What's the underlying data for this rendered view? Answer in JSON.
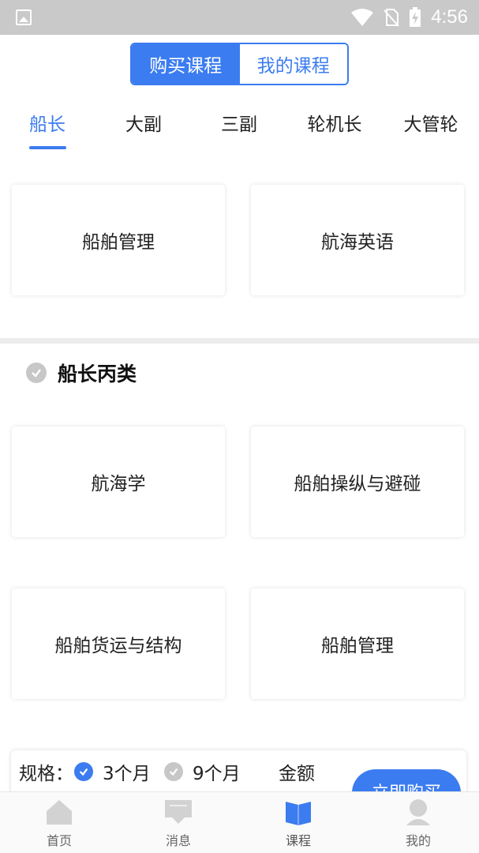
{
  "status_bar": {
    "time": "4:56"
  },
  "segment": {
    "buy_label": "购买课程",
    "mine_label": "我的课程"
  },
  "tabs": [
    "船长",
    "大副",
    "三副",
    "轮机长",
    "大管轮"
  ],
  "top_cards": [
    "船舶管理",
    "航海英语"
  ],
  "section": {
    "title": "船长丙类",
    "cards": [
      "航海学",
      "船舶操纵与避碰",
      "船舶货运与结构",
      "船舶管理"
    ]
  },
  "purchase": {
    "spec_label": "规格：",
    "option_1": "3个月",
    "option_2": "9个月",
    "amount_label": "金额",
    "buy_label": "立即购买"
  },
  "nav": {
    "home": "首页",
    "messages": "消息",
    "courses": "课程",
    "mine": "我的"
  },
  "colors": {
    "accent": "#3b7cf0",
    "status_bar": "#c9c9c9",
    "inactive_icon": "#c7c7c7"
  }
}
